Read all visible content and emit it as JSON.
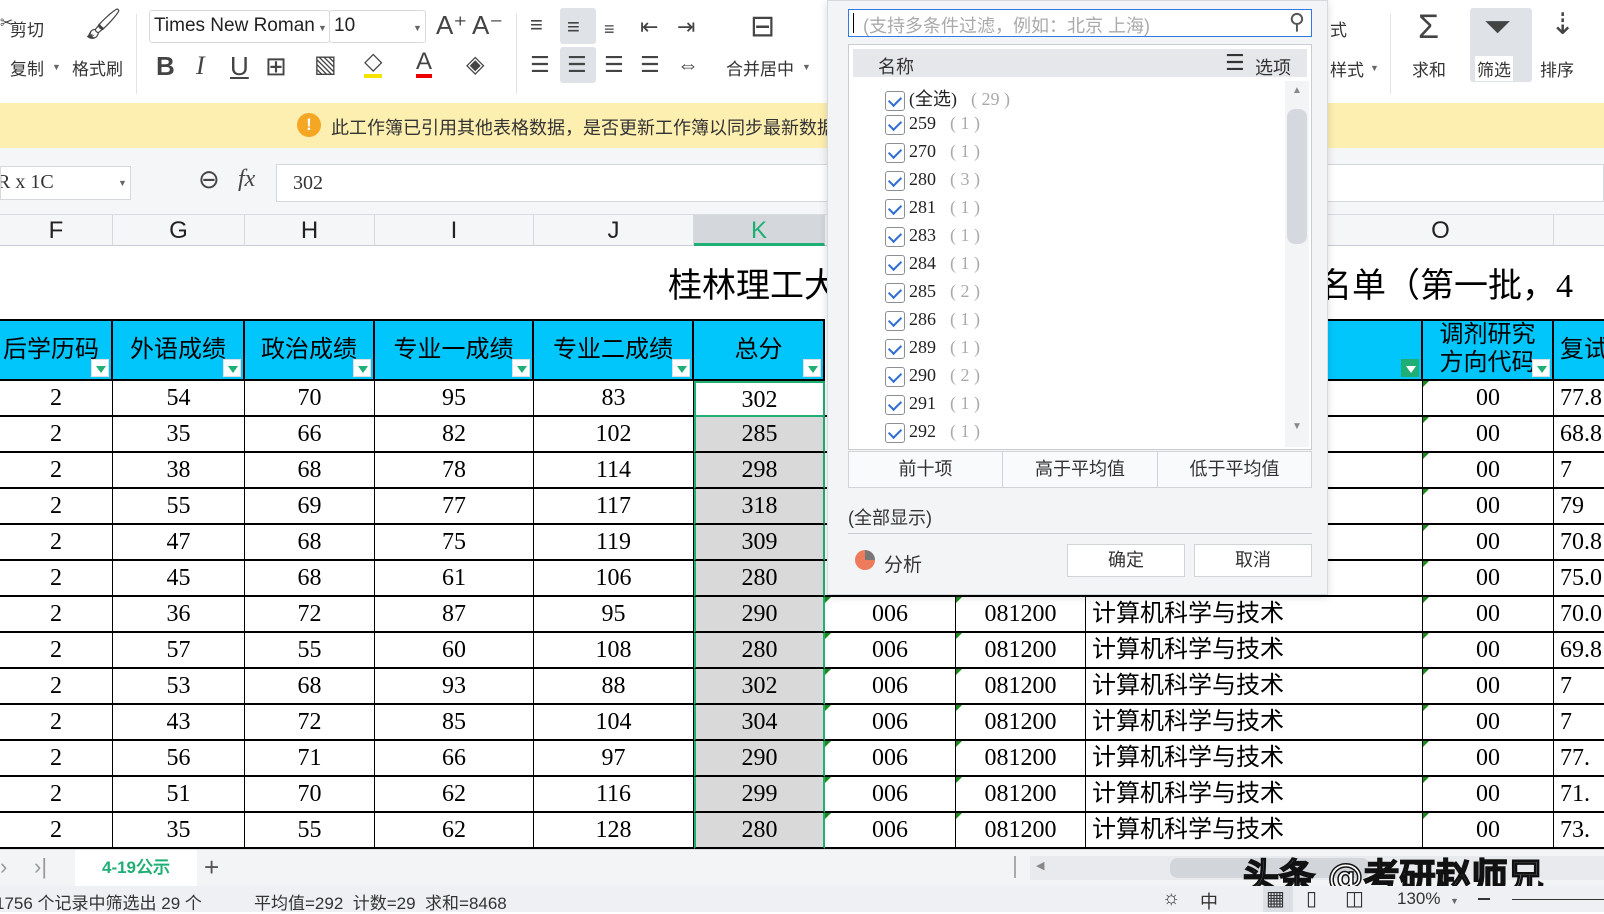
{
  "ribbon": {
    "cut": "剪切",
    "copy": "复制",
    "format_painter": "格式刷",
    "font_name": "Times New Roman",
    "font_size": "10",
    "merge_center": "合并居中",
    "style_top": "式",
    "styles": "样式",
    "sum": "求和",
    "filter": "筛选",
    "sort": "排序"
  },
  "notice": {
    "text": "此工作簿已引用其他表格数据，是否更新工作簿以同步最新数据"
  },
  "formula_bar": {
    "name_box": "R x 1C",
    "fx": "fx",
    "value": "302"
  },
  "columns": [
    "F",
    "G",
    "H",
    "I",
    "J",
    "K",
    "O"
  ],
  "title": {
    "left": "桂林理工大",
    "right": "名单（第一批，4"
  },
  "headers": {
    "F": "后学历码",
    "G": "外语成绩",
    "H": "政治成绩",
    "I": "专业一成绩",
    "J": "专业二成绩",
    "K": "总分",
    "O1": "调剂研究",
    "O2": "方向代码",
    "P": "复试"
  },
  "rows": [
    {
      "F": "2",
      "G": "54",
      "H": "70",
      "I": "95",
      "J": "83",
      "K": "302",
      "L": "",
      "M": "",
      "N": "",
      "O": "00",
      "P": "77.8"
    },
    {
      "F": "2",
      "G": "35",
      "H": "66",
      "I": "82",
      "J": "102",
      "K": "285",
      "L": "",
      "M": "",
      "N": "",
      "O": "00",
      "P": "68.8"
    },
    {
      "F": "2",
      "G": "38",
      "H": "68",
      "I": "78",
      "J": "114",
      "K": "298",
      "L": "",
      "M": "",
      "N": "",
      "O": "00",
      "P": "7"
    },
    {
      "F": "2",
      "G": "55",
      "H": "69",
      "I": "77",
      "J": "117",
      "K": "318",
      "L": "",
      "M": "",
      "N": "",
      "O": "00",
      "P": "79"
    },
    {
      "F": "2",
      "G": "47",
      "H": "68",
      "I": "75",
      "J": "119",
      "K": "309",
      "L": "",
      "M": "",
      "N": "",
      "O": "00",
      "P": "70.8"
    },
    {
      "F": "2",
      "G": "45",
      "H": "68",
      "I": "61",
      "J": "106",
      "K": "280",
      "L": "",
      "M": "",
      "N": "",
      "O": "00",
      "P": "75.0"
    },
    {
      "F": "2",
      "G": "36",
      "H": "72",
      "I": "87",
      "J": "95",
      "K": "290",
      "L": "006",
      "M": "081200",
      "N": "计算机科学与技术",
      "O": "00",
      "P": "70.0"
    },
    {
      "F": "2",
      "G": "57",
      "H": "55",
      "I": "60",
      "J": "108",
      "K": "280",
      "L": "006",
      "M": "081200",
      "N": "计算机科学与技术",
      "O": "00",
      "P": "69.8"
    },
    {
      "F": "2",
      "G": "53",
      "H": "68",
      "I": "93",
      "J": "88",
      "K": "302",
      "L": "006",
      "M": "081200",
      "N": "计算机科学与技术",
      "O": "00",
      "P": "7"
    },
    {
      "F": "2",
      "G": "43",
      "H": "72",
      "I": "85",
      "J": "104",
      "K": "304",
      "L": "006",
      "M": "081200",
      "N": "计算机科学与技术",
      "O": "00",
      "P": "7"
    },
    {
      "F": "2",
      "G": "56",
      "H": "71",
      "I": "66",
      "J": "97",
      "K": "290",
      "L": "006",
      "M": "081200",
      "N": "计算机科学与技术",
      "O": "00",
      "P": "77."
    },
    {
      "F": "2",
      "G": "51",
      "H": "70",
      "I": "62",
      "J": "116",
      "K": "299",
      "L": "006",
      "M": "081200",
      "N": "计算机科学与技术",
      "O": "00",
      "P": "71."
    },
    {
      "F": "2",
      "G": "35",
      "H": "55",
      "I": "62",
      "J": "128",
      "K": "280",
      "L": "006",
      "M": "081200",
      "N": "计算机科学与技术",
      "O": "00",
      "P": "73."
    }
  ],
  "filter_panel": {
    "search_placeholder": "(支持多条件过滤，例如：北京 上海)",
    "col_name": "名称",
    "options": "选项",
    "items": [
      {
        "label": "(全选)",
        "count": "( 29 )",
        "checked": true
      },
      {
        "label": "259",
        "count": "( 1 )",
        "checked": true
      },
      {
        "label": "270",
        "count": "( 1 )",
        "checked": true
      },
      {
        "label": "280",
        "count": "( 3 )",
        "checked": true
      },
      {
        "label": "281",
        "count": "( 1 )",
        "checked": true
      },
      {
        "label": "283",
        "count": "( 1 )",
        "checked": true
      },
      {
        "label": "284",
        "count": "( 1 )",
        "checked": true
      },
      {
        "label": "285",
        "count": "( 2 )",
        "checked": true
      },
      {
        "label": "286",
        "count": "( 1 )",
        "checked": true
      },
      {
        "label": "289",
        "count": "( 1 )",
        "checked": true
      },
      {
        "label": "290",
        "count": "( 2 )",
        "checked": true
      },
      {
        "label": "291",
        "count": "( 1 )",
        "checked": true
      },
      {
        "label": "292",
        "count": "( 1 )",
        "checked": true
      }
    ],
    "top10": "前十项",
    "above_avg": "高于平均值",
    "below_avg": "低于平均值",
    "show_all": "(全部显示)",
    "analyze": "分析",
    "ok": "确定",
    "cancel": "取消"
  },
  "sheet_tabs": {
    "active": "4-19公示",
    "add": "+"
  },
  "status": {
    "filter_info": "1756 个记录中筛选出 29 个",
    "stats": "平均值=292  计数=29  求和=8468",
    "zoom": "130%",
    "ime": "中"
  },
  "watermark": "头条 @考研赵师兄",
  "colors": {
    "header_bg": "#00c6fc",
    "accent_green": "#1fae74",
    "notice_bg": "#fdefb0",
    "checkbox_blue": "#2f6fd6"
  }
}
